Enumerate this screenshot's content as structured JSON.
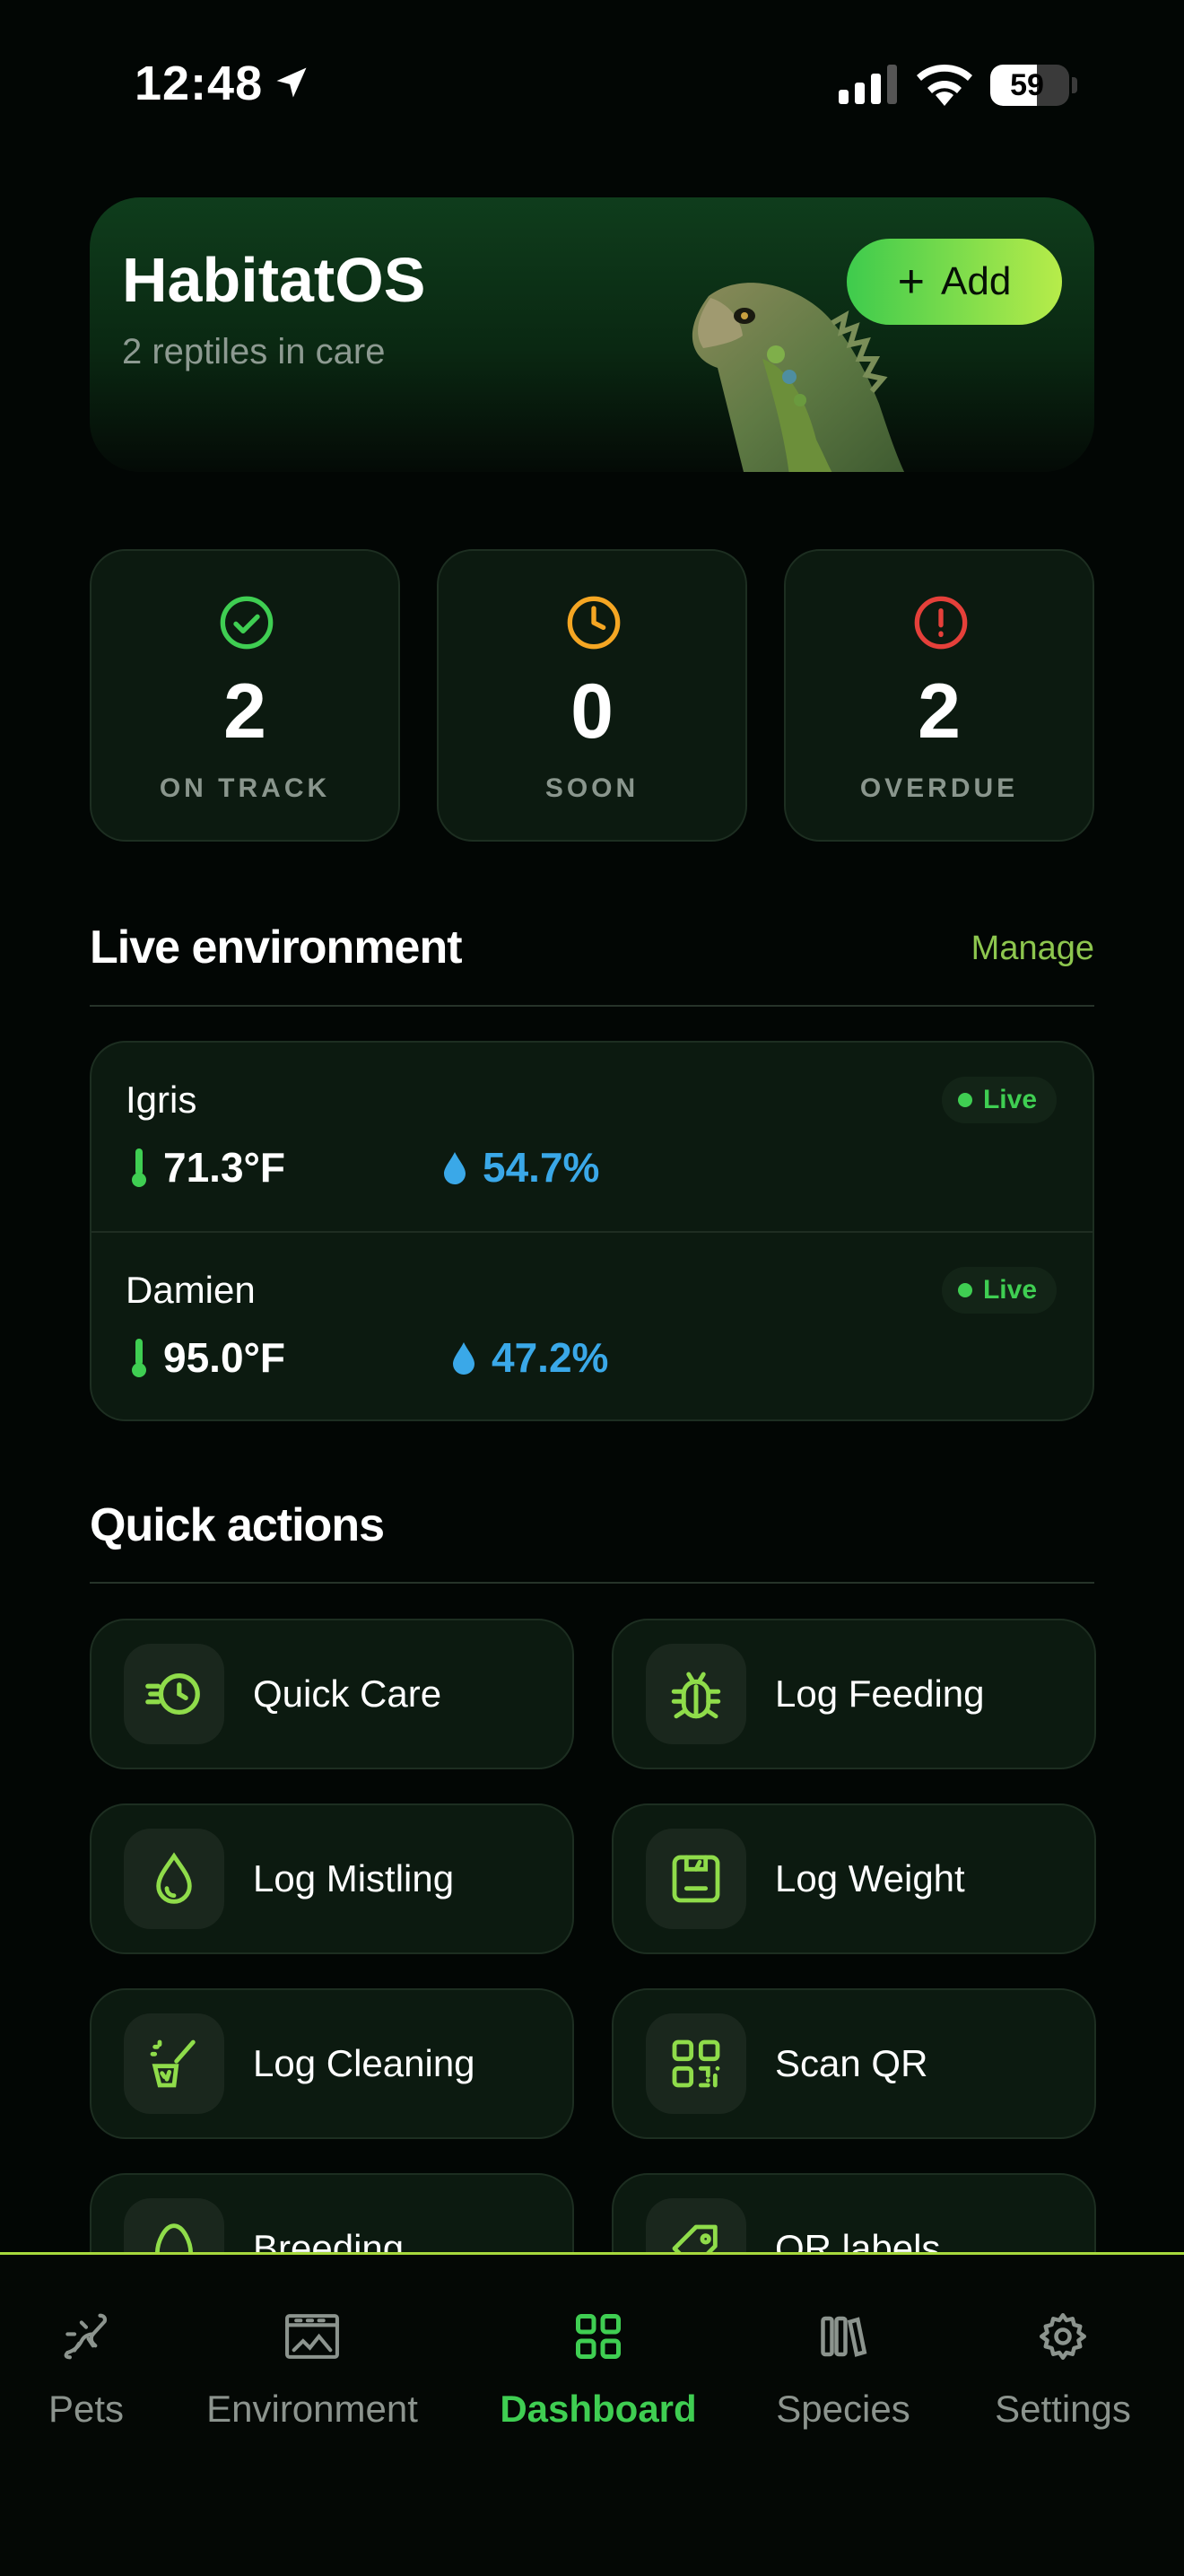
{
  "status_bar": {
    "time": "12:48",
    "battery": "59",
    "battery_level": 0.59
  },
  "header": {
    "title": "HabitatOS",
    "subtitle": "2 reptiles in care",
    "add_label": "Add"
  },
  "stats": [
    {
      "value": "2",
      "label": "ON TRACK",
      "icon": "check-circle-icon",
      "color": "#3fce52"
    },
    {
      "value": "0",
      "label": "SOON",
      "icon": "clock-icon",
      "color": "#f5a623"
    },
    {
      "value": "2",
      "label": "OVERDUE",
      "icon": "alert-circle-icon",
      "color": "#e5403a"
    }
  ],
  "environment": {
    "title": "Live environment",
    "manage_label": "Manage",
    "live_label": "Live",
    "pets": [
      {
        "name": "Igris",
        "temp": "71.3°F",
        "humidity": "54.7%"
      },
      {
        "name": "Damien",
        "temp": "95.0°F",
        "humidity": "47.2%"
      }
    ]
  },
  "quick_actions": {
    "title": "Quick actions",
    "items": [
      {
        "label": "Quick Care",
        "icon": "quick-care-clock-icon"
      },
      {
        "label": "Log Feeding",
        "icon": "bug-icon"
      },
      {
        "label": "Log Mistling",
        "icon": "droplet-icon"
      },
      {
        "label": "Log Weight",
        "icon": "scale-icon"
      },
      {
        "label": "Log Cleaning",
        "icon": "cleaning-brush-icon"
      },
      {
        "label": "Scan QR",
        "icon": "qr-code-icon"
      },
      {
        "label": "Breeding",
        "icon": "egg-icon"
      },
      {
        "label": "QR labels",
        "icon": "tag-icon"
      }
    ]
  },
  "tabs": [
    {
      "label": "Pets",
      "icon": "lizard-icon"
    },
    {
      "label": "Environment",
      "icon": "terrarium-icon"
    },
    {
      "label": "Dashboard",
      "icon": "grid-icon",
      "active": true
    },
    {
      "label": "Species",
      "icon": "books-icon"
    },
    {
      "label": "Settings",
      "icon": "gear-icon"
    }
  ],
  "colors": {
    "accent": "#3fce52",
    "lime": "#b7ec4a",
    "humidity": "#3aa8e8",
    "background": "#020604"
  }
}
